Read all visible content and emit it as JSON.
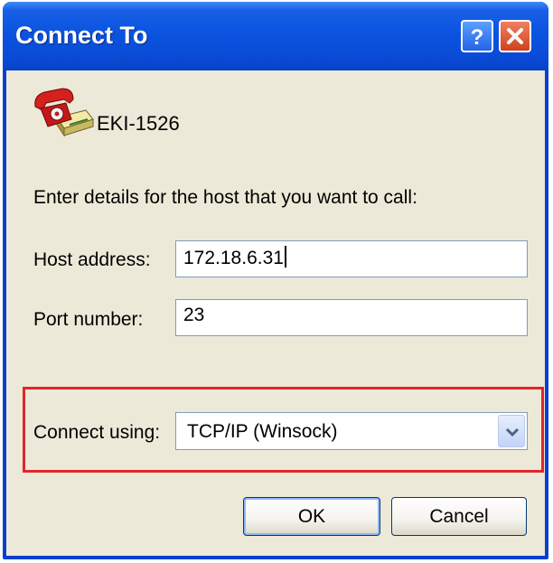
{
  "window": {
    "title": "Connect To"
  },
  "title_buttons": {
    "help_icon": "help-icon",
    "close_icon": "close-icon"
  },
  "connection": {
    "name": "EKI-1526",
    "icon": "phone-icon"
  },
  "form": {
    "instructions": "Enter details for the host that you want to call:",
    "host_label": "Host address:",
    "host_value": "172.18.6.31",
    "port_label": "Port number:",
    "port_value": "23",
    "connect_label": "Connect using:",
    "connect_value": "TCP/IP (Winsock)"
  },
  "buttons": {
    "ok": "OK",
    "cancel": "Cancel"
  },
  "colors": {
    "titlebar": "#0a54e0",
    "highlight_border": "#e0262b",
    "client_bg": "#ece9d8"
  }
}
